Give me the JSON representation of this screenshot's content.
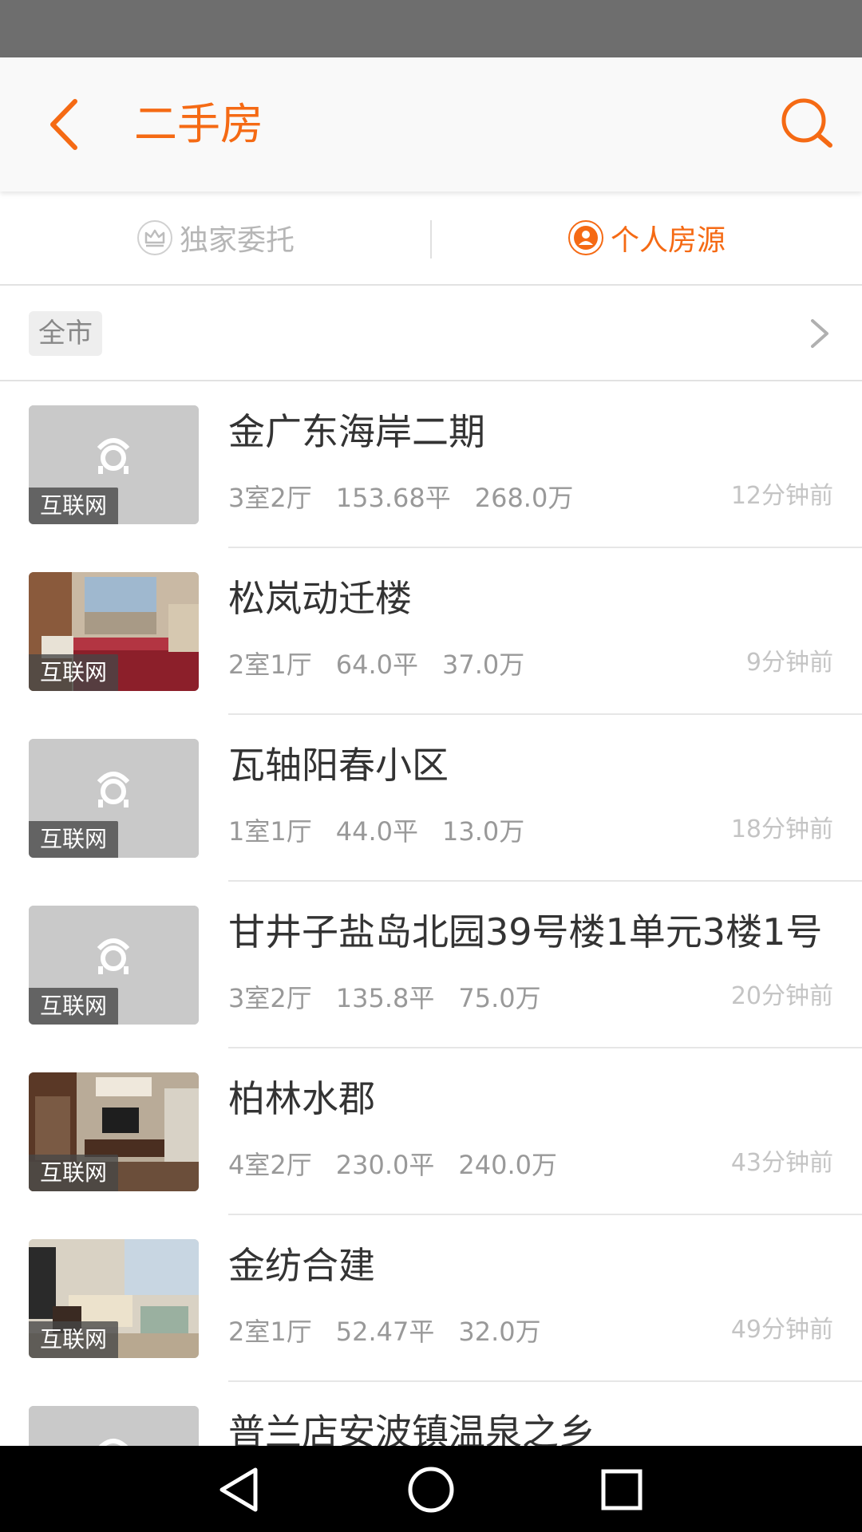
{
  "app_bar": {
    "title": "二手房",
    "back_icon": "chevron-left-icon",
    "search_icon": "search-icon",
    "accent_color": "#f56a14"
  },
  "tabs": [
    {
      "label": "独家委托",
      "icon": "crown-icon",
      "active": false
    },
    {
      "label": "个人房源",
      "icon": "person-icon",
      "active": true
    }
  ],
  "filter": {
    "area": "全市",
    "icon": "chevron-right-icon"
  },
  "listings": [
    {
      "title": "金广东海岸二期",
      "layout": "3室2厅",
      "area": "153.68平",
      "price": "268.0万",
      "time": "12分钟前",
      "source": "互联网",
      "image": "placeholder"
    },
    {
      "title": "松岚动迁楼",
      "layout": "2室1厅",
      "area": "64.0平",
      "price": "37.0万",
      "time": "9分钟前",
      "source": "互联网",
      "image": "bedroom-photo"
    },
    {
      "title": "瓦轴阳春小区",
      "layout": "1室1厅",
      "area": "44.0平",
      "price": "13.0万",
      "time": "18分钟前",
      "source": "互联网",
      "image": "placeholder"
    },
    {
      "title": "甘井子盐岛北园39号楼1单元3楼1号",
      "layout": "3室2厅",
      "area": "135.8平",
      "price": "75.0万",
      "time": "20分钟前",
      "source": "互联网",
      "image": "placeholder"
    },
    {
      "title": "柏林水郡",
      "layout": "4室2厅",
      "area": "230.0平",
      "price": "240.0万",
      "time": "43分钟前",
      "source": "互联网",
      "image": "livingroom-photo"
    },
    {
      "title": "金纺合建",
      "layout": "2室1厅",
      "area": "52.47平",
      "price": "32.0万",
      "time": "49分钟前",
      "source": "互联网",
      "image": "livingroom-photo-2"
    },
    {
      "title": "普兰店安波镇温泉之乡",
      "layout": "",
      "area": "",
      "price": "",
      "time": "",
      "source": "",
      "image": "placeholder"
    }
  ],
  "nav": {
    "back_icon": "triangle-back-icon",
    "home_icon": "circle-home-icon",
    "recents_icon": "square-recents-icon"
  }
}
